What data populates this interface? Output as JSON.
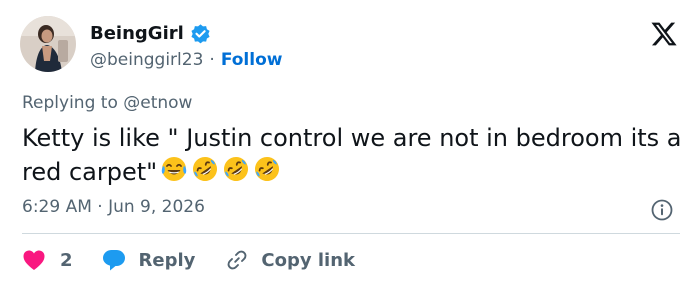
{
  "author": {
    "display_name": "BeingGirl",
    "handle": "@beinggirl23",
    "separator": "·",
    "follow_label": "Follow"
  },
  "reply": {
    "prefix": "Replying to",
    "to": "@etnow"
  },
  "tweet": {
    "text": "Ketty is like \" Justin control we are not in bedroom its a red carpet\"",
    "emojis": [
      "face-with-tears-of-joy",
      "rolling-on-the-floor-laughing",
      "rolling-on-the-floor-laughing",
      "rolling-on-the-floor-laughing"
    ]
  },
  "meta": {
    "timestamp": "6:29 AM · Jun 9, 2026"
  },
  "actions": {
    "like_count": "2",
    "reply_label": "Reply",
    "copy_link_label": "Copy link"
  },
  "colors": {
    "accent": "#1d9bf0",
    "follow": "#006fd6",
    "heart": "#f91880",
    "muted": "#536471",
    "text": "#0f1419",
    "divider": "#cfd9de"
  }
}
